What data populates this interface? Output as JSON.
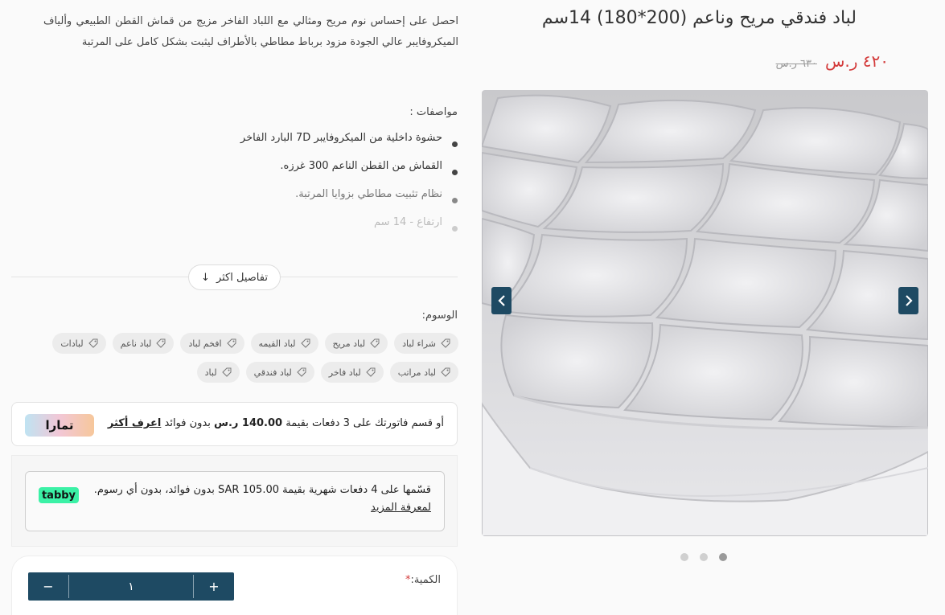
{
  "product": {
    "title": "لباد فندقي مريح وناعم (200*180) 14سم",
    "price_new": "٤٢٠ ر.س",
    "price_old": "٦٣٠ ر.س"
  },
  "description": "احصل على إحساس نوم مريح ومثالي مع اللباد الفاخر مزيج من قماش القطن الطبيعي وألياف الميكروفايبر عالي الجودة مزود برباط مطاطي بالأطراف ليثبت بشكل كامل على المرتبة",
  "specs": {
    "title": "مواصفات :",
    "items": [
      "حشوة داخلية من الميكروفايبر 7D البارد الفاخر",
      "القماش من القطن الناعم 300 غرزه.",
      "نظام تثبيت مطاطي بزوايا المرتبة.",
      "ارتفاع - 14 سم"
    ]
  },
  "more_details": "تفاصيل اكثر",
  "tags": {
    "title": "الوسوم:",
    "items": [
      "شراء لباد",
      "لباد مريح",
      "لباد القيمه",
      "افخم لباد",
      "لباد ناعم",
      "لبادات",
      "لباد مراتب",
      "لباد فاخر",
      "لباد فندقي",
      "لباد"
    ]
  },
  "tamara": {
    "text_before": "أو قسم فاتورتك على 3 دفعات بقيمة",
    "amount": "140.00 ر.س",
    "text_after": "بدون فوائد",
    "link": "اعرف أكثر",
    "logo": "تمارا"
  },
  "tabby": {
    "text": "قسّمها على 4 دفعات شهرية بقيمة SAR 105.00 بدون فوائد، بدون أي رسوم. لمعرفة المزيد",
    "link": "لمعرفة المزيد",
    "logo": "tabby"
  },
  "quantity": {
    "label": "الكمية:",
    "required_mark": "*",
    "value": "١",
    "plus": "+",
    "minus": "−"
  },
  "gallery": {
    "slides": 3,
    "active_slide": 3
  },
  "colors": {
    "accent": "#1e4a63",
    "price": "#d33a3a",
    "tabby": "#3bf1a6"
  }
}
